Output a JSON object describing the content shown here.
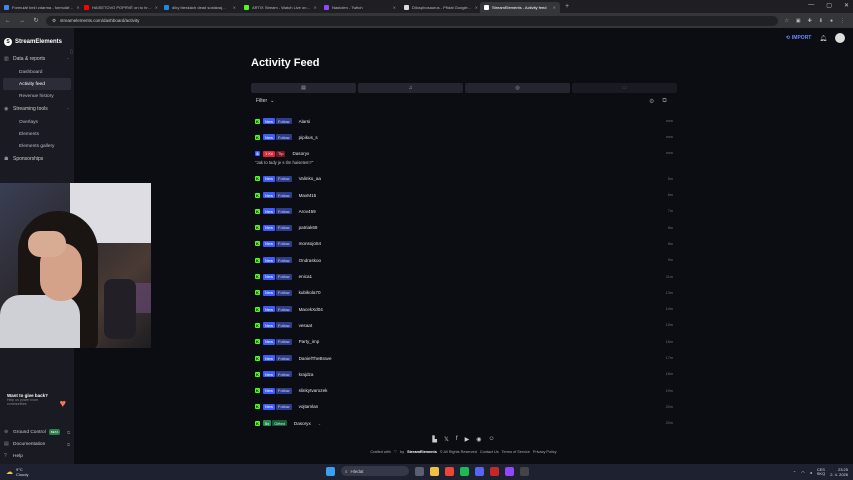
{
  "browser": {
    "tabs": [
      {
        "label": "Formulář beží zdarma - formulář…",
        "color": "#4285f4"
      },
      {
        "label": "HAISETOVO POPRVÉ on to hr…",
        "color": "#ff0000"
      },
      {
        "label": "díky bleskách dead sostávaj…",
        "color": "#1e88e5"
      },
      {
        "label": "ARTIX Stream - Watch Live on…",
        "color": "#53fc18"
      },
      {
        "label": "Nastolen - Twitch",
        "color": "#9146ff"
      },
      {
        "label": "Dilosphosaurus - Přidat Google…",
        "color": "#dddddd"
      },
      {
        "label": "StreamElements - Activity feed",
        "color": "#ffffff"
      }
    ],
    "new_tab": "+",
    "url": "streamelements.com/dashboard/activity"
  },
  "sidebar": {
    "brand": "StreamElements",
    "sections": [
      {
        "label": "Data & reports",
        "icon": "chart-icon",
        "items": [
          "Dashboard",
          "Activity feed",
          "Revenue history"
        ]
      },
      {
        "label": "Streaming tools",
        "icon": "broadcast-icon",
        "items": [
          "Overlays",
          "Elements",
          "Elements gallery"
        ]
      },
      {
        "label": "Sponsorships",
        "icon": "handshake-icon",
        "items": []
      }
    ],
    "active_item": "Activity feed",
    "promo": {
      "title": "Want to give back?",
      "subtitle": "Help us power more communities"
    },
    "bottom": [
      {
        "label": "Ground Control",
        "badge": "BETA",
        "icon": "globe-icon"
      },
      {
        "label": "Documentation",
        "icon": "book-icon"
      },
      {
        "label": "Help",
        "icon": "help-icon"
      }
    ]
  },
  "topbar": {
    "import_label": "IMPORT"
  },
  "page": {
    "title": "Activity Feed",
    "filter_label": "Filter"
  },
  "feed": [
    {
      "type": "follow",
      "new": "New",
      "kind": "Follow",
      "user": "Alarsi",
      "time": "now"
    },
    {
      "type": "follow",
      "new": "New",
      "kind": "Follow",
      "user": "pipikus_s",
      "time": "now"
    },
    {
      "type": "tip",
      "amount": "1 Kč",
      "kind": "Tip",
      "user": "Dasoryx",
      "message": "\"Jak to tady je s tím haisetem?\"",
      "time": "now"
    },
    {
      "type": "follow",
      "new": "New",
      "kind": "Follow",
      "user": "Valinko_aa",
      "time": "5m"
    },
    {
      "type": "follow",
      "new": "New",
      "kind": "Follow",
      "user": "MaxM15",
      "time": "6m"
    },
    {
      "type": "follow",
      "new": "New",
      "kind": "Follow",
      "user": "Arov459",
      "time": "7m"
    },
    {
      "type": "follow",
      "new": "New",
      "kind": "Follow",
      "user": "patriak69",
      "time": "8m"
    },
    {
      "type": "follow",
      "new": "New",
      "kind": "Follow",
      "user": "monsojo54",
      "time": "8m"
    },
    {
      "type": "follow",
      "new": "New",
      "kind": "Follow",
      "user": "Ondraskoo",
      "time": "9m"
    },
    {
      "type": "follow",
      "new": "New",
      "kind": "Follow",
      "user": "enica1",
      "time": "11m"
    },
    {
      "type": "follow",
      "new": "New",
      "kind": "Follow",
      "user": "kubikola70",
      "time": "13m"
    },
    {
      "type": "follow",
      "new": "New",
      "kind": "Follow",
      "user": "MacekXd04",
      "time": "14m"
    },
    {
      "type": "follow",
      "new": "New",
      "kind": "Follow",
      "user": "vesaat",
      "time": "15m"
    },
    {
      "type": "follow",
      "new": "New",
      "kind": "Follow",
      "user": "Party_imp",
      "time": "16m"
    },
    {
      "type": "follow",
      "new": "New",
      "kind": "Follow",
      "user": "DanielTheBrave",
      "time": "17m"
    },
    {
      "type": "follow",
      "new": "New",
      "kind": "Follow",
      "user": "krajdza",
      "time": "18m"
    },
    {
      "type": "follow",
      "new": "New",
      "kind": "Follow",
      "user": "slinkytvarozek",
      "time": "19m"
    },
    {
      "type": "follow",
      "new": "New",
      "kind": "Follow",
      "user": "vojtamlan",
      "time": "20m"
    },
    {
      "type": "gift",
      "count": "5x",
      "kind": "Gifted",
      "user": "Dasoryx",
      "time": "20m"
    }
  ],
  "footer": {
    "crafted_prefix": "Crafted with",
    "crafted_by": "by",
    "brand": "StreamElements",
    "rights": "© All Rights Reserved",
    "contact": "Contact Us",
    "terms": "Terms of Service",
    "privacy": "Privacy Policy"
  },
  "taskbar": {
    "temp": "9°C",
    "weather": "Cloudy",
    "search_placeholder": "Hledat",
    "lang": "CES\nSKQ",
    "time": "23:25",
    "date": "2. 4. 2026"
  }
}
